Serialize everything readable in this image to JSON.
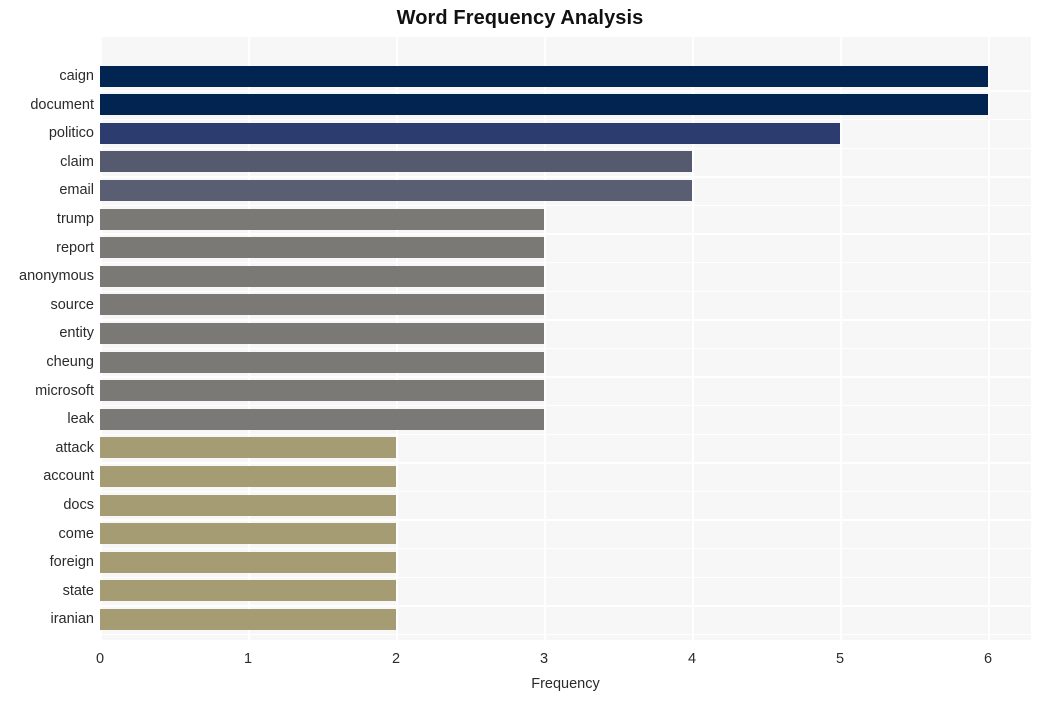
{
  "chart_data": {
    "type": "bar",
    "orientation": "horizontal",
    "title": "Word Frequency Analysis",
    "xlabel": "Frequency",
    "ylabel": "",
    "xlim": [
      0,
      6
    ],
    "xticks": [
      0,
      1,
      2,
      3,
      4,
      5,
      6
    ],
    "grid": true,
    "legend": false,
    "categories": [
      "caign",
      "document",
      "politico",
      "claim",
      "email",
      "trump",
      "report",
      "anonymous",
      "source",
      "entity",
      "cheung",
      "microsoft",
      "leak",
      "attack",
      "account",
      "docs",
      "come",
      "foreign",
      "state",
      "iranian"
    ],
    "values": [
      6,
      6,
      5,
      4,
      4,
      3,
      3,
      3,
      3,
      3,
      3,
      3,
      3,
      2,
      2,
      2,
      2,
      2,
      2,
      2
    ],
    "bar_colors": [
      "#022450",
      "#022450",
      "#2c3c6e",
      "#555a6e",
      "#5a5e72",
      "#7b7975",
      "#7b7975",
      "#7b7975",
      "#7b7975",
      "#7b7975",
      "#7b7975",
      "#7b7975",
      "#7b7975",
      "#a59c74",
      "#a59c74",
      "#a59c74",
      "#a59c74",
      "#a59c74",
      "#a59c74",
      "#a59c74"
    ],
    "plot_background": "#f7f7f7",
    "grid_color": "#ffffff",
    "figure_background": "#ffffff",
    "text_color": "#2b2b2b"
  }
}
